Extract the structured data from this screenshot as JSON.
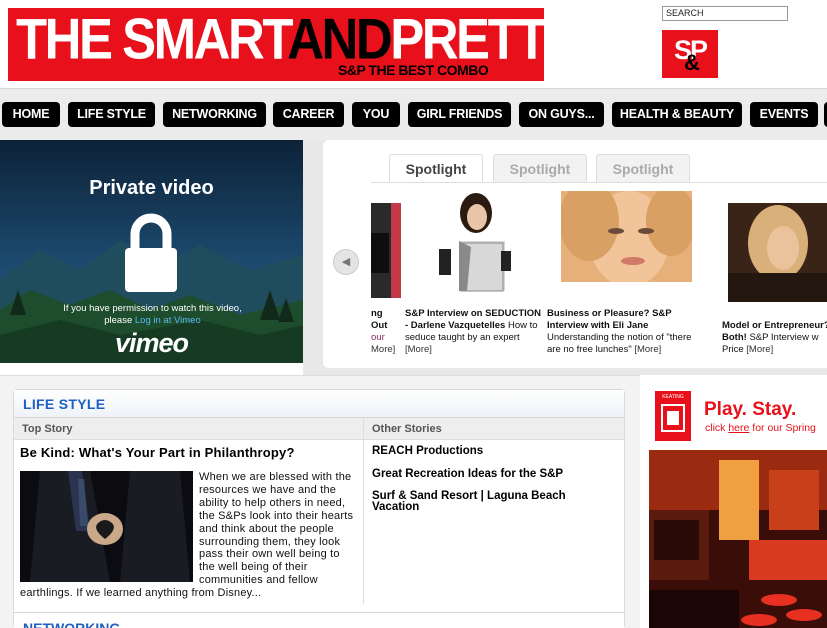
{
  "header": {
    "logo_part1": "THE SMART",
    "logo_part2": "AND",
    "logo_part3": "PRETTY",
    "tagline": "S&P THE BEST COMBO",
    "search_placeholder": "SEARCH",
    "badge_s": "S",
    "badge_p": "P",
    "badge_amp": "&"
  },
  "nav": {
    "items": [
      "HOME",
      "LIFE STYLE",
      "NETWORKING",
      "CAREER",
      "YOU",
      "GIRL FRIENDS",
      "ON GUYS...",
      "HEALTH & BEAUTY",
      "EVENTS"
    ]
  },
  "video": {
    "title": "Private video",
    "message_prefix": "If you have permission to watch this video, please",
    "message_link": "Log in at Vimeo",
    "brand": "vimeo"
  },
  "spotlight": {
    "tabs": [
      "Spotlight",
      "Spotlight",
      "Spotlight"
    ],
    "partial_left": {
      "line1": "ng Out",
      "line2": "our",
      "more": "More]"
    },
    "items": [
      {
        "title": "S&P Interview on SEDUCTION - Darlene Vazquetelles",
        "desc": "How to seduce taught by an expert",
        "more": "[More]"
      },
      {
        "title": "Business or Pleasure? S&P Interview with Eli Jane",
        "desc": "Understanding the notion of \"there are no free lunches\"",
        "more": "[More]"
      },
      {
        "title": "Model or Entrepreneur? Both!",
        "desc": "S&P Interview w Price",
        "more": "[More]"
      }
    ]
  },
  "lifestyle": {
    "section_title": "LIFE STYLE",
    "top_story_label": "Top Story",
    "other_stories_label": "Other Stories",
    "top_story_title": "Be Kind: What's Your Part in Philanthropy?",
    "top_story_body": "When we are blessed with the resources we have and the ability to help others in need, the S&Ps look into their hearts and think about the people surrounding them, they look pass their own well being to the well being of their communities and fellow earthlings. If we learned anything from Disney...",
    "other_stories": [
      "REACH Productions",
      "Great Recreation Ideas for the S&P",
      "Surf & Sand Resort | Laguna Beach Vacation"
    ],
    "next_section_title": "NETWORKING"
  },
  "ad": {
    "logo_text": "KEATING",
    "headline": "Play. Stay.",
    "sub_prefix": "click",
    "sub_link": "here",
    "sub_suffix": "for our Spring"
  },
  "colors": {
    "brand_red": "#e8111b",
    "section_blue": "#1f5fbf",
    "nav_black": "#000000"
  }
}
